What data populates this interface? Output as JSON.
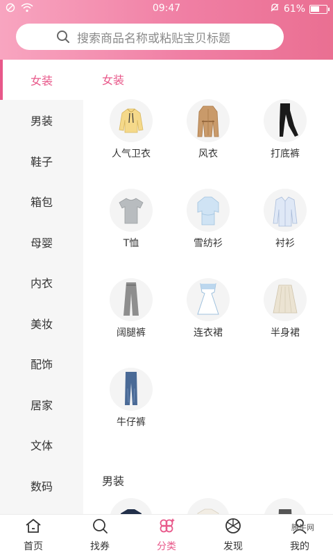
{
  "status": {
    "time": "09:47",
    "battery": "61%",
    "battery_level": 0.61
  },
  "search": {
    "placeholder": "搜索商品名称或粘贴宝贝标题"
  },
  "sidebar": {
    "items": [
      {
        "label": "女装",
        "active": true
      },
      {
        "label": "男装"
      },
      {
        "label": "鞋子"
      },
      {
        "label": "箱包"
      },
      {
        "label": "母婴"
      },
      {
        "label": "内衣"
      },
      {
        "label": "美妆"
      },
      {
        "label": "配饰"
      },
      {
        "label": "居家"
      },
      {
        "label": "文体"
      },
      {
        "label": "数码"
      }
    ]
  },
  "content": {
    "sections": [
      {
        "title": "女装",
        "items": [
          {
            "label": "人气卫衣",
            "icon": "hoodie-icon"
          },
          {
            "label": "风衣",
            "icon": "trench-coat-icon"
          },
          {
            "label": "打底裤",
            "icon": "leggings-icon"
          },
          {
            "label": "T恤",
            "icon": "tshirt-icon"
          },
          {
            "label": "雪纺衫",
            "icon": "chiffon-shirt-icon"
          },
          {
            "label": "衬衫",
            "icon": "shirt-icon"
          },
          {
            "label": "阔腿裤",
            "icon": "wide-leg-pants-icon"
          },
          {
            "label": "连衣裙",
            "icon": "dress-icon"
          },
          {
            "label": "半身裙",
            "icon": "skirt-icon"
          },
          {
            "label": "牛仔裤",
            "icon": "jeans-icon"
          }
        ]
      },
      {
        "title": "男装",
        "items": []
      }
    ]
  },
  "tabbar": {
    "items": [
      {
        "label": "首页",
        "icon": "home-icon"
      },
      {
        "label": "找券",
        "icon": "search-icon"
      },
      {
        "label": "分类",
        "icon": "category-flower-icon",
        "active": true
      },
      {
        "label": "发现",
        "icon": "discover-icon"
      },
      {
        "label": "我的",
        "icon": "profile-icon"
      }
    ]
  },
  "watermark": "腾牛网",
  "colors": {
    "accent": "#e8588a",
    "header_start": "#f8a5c0",
    "header_end": "#ea6f92"
  }
}
